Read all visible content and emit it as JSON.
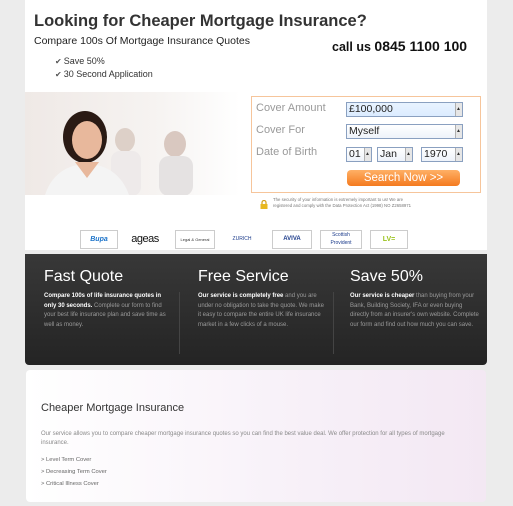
{
  "header": {
    "headline": "Looking for Cheaper Mortgage Insurance?",
    "subline": "Compare 100s Of Mortgage Insurance Quotes",
    "call_label": "call us",
    "phone": "0845 1100 100",
    "checks": [
      "Save 50%",
      "30 Second Application"
    ]
  },
  "form": {
    "cover_amount_label": "Cover Amount",
    "cover_amount_value": "£100,000",
    "cover_for_label": "Cover For",
    "cover_for_value": "Myself",
    "dob_label": "Date of Birth",
    "dob_day": "01",
    "dob_month": "Jan",
    "dob_year": "1970",
    "search_button": "Search Now >>",
    "security_line1": "The security of your information is extremely important to us! We are",
    "security_line2": "registered and comply with the Data Protection Act (1998) NO Z2658971"
  },
  "insurers": [
    "Bupa",
    "ageas",
    "Legal & General",
    "ZURICH",
    "AVIVA",
    "Scottish Provident",
    "LV="
  ],
  "features": [
    {
      "title": "Fast Quote",
      "bold": "Compare 100s of life insurance quotes in only 30 seconds.",
      "text": " Complete our form to find your best life insurance plan and save time as well as money."
    },
    {
      "title": "Free Service",
      "bold": "Our service is completely free",
      "text": " and you are under no obligation to take the quote. We make it easy to compare the entire UK life insurance market in a few clicks of a mouse."
    },
    {
      "title": "Save 50%",
      "bold": "Our service is cheaper",
      "text": " than buying from your Bank, Building Society, IFA or even buying directly from an insurer's own website. Complete our form and find out how much you can save."
    }
  ],
  "info": {
    "title": "Cheaper Mortgage Insurance",
    "description": "Our service allows you to compare cheaper mortgage insurance quotes so you can find the best value deal. We offer protection for all types of mortgage insurance.",
    "items": [
      "Level Term Cover",
      "Decreasing Term Cover",
      "Critical Illness Cover"
    ]
  },
  "colors": {
    "accent_orange": "#f47a1f",
    "band_dark": "#2b2b2b"
  }
}
